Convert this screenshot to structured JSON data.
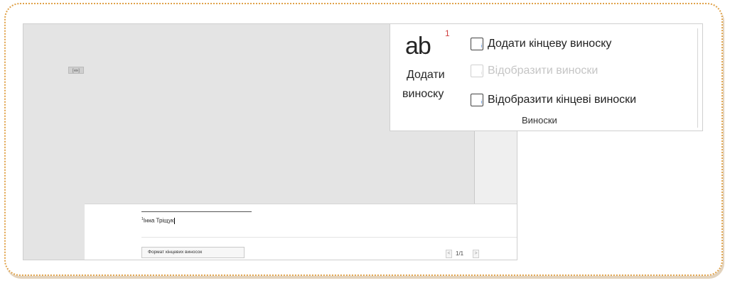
{
  "document": {
    "anchor_mark": "[нн]",
    "endnote": {
      "number": "1",
      "text": "Інна Тріщук"
    },
    "format_button_label": "Формат кінцевих виносок",
    "pager": {
      "prev": "<",
      "count": "1/1",
      "next": ">"
    }
  },
  "ribbon": {
    "big_button": {
      "icon_text": "ab",
      "icon_superscript": "1",
      "label_line1": "Додати",
      "label_line2": "виноску"
    },
    "commands": [
      {
        "label": "Додати кінцеву виноску",
        "icon": "insert-endnote-icon",
        "enabled": true
      },
      {
        "label": "Відобразити виноски",
        "icon": "show-footnotes-icon",
        "enabled": false
      },
      {
        "label": "Відобразити кінцеві виноски",
        "icon": "show-endnotes-icon",
        "enabled": true
      }
    ],
    "group_label": "Виноски"
  }
}
